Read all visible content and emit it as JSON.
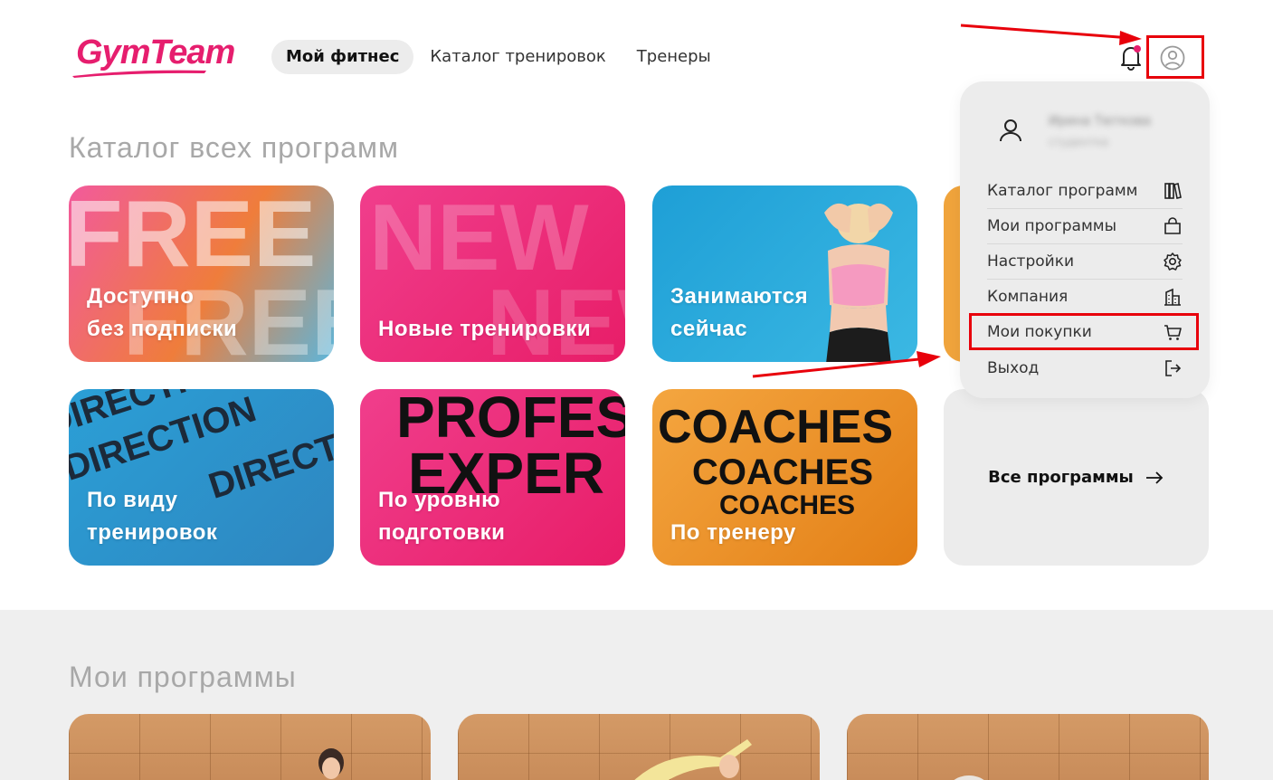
{
  "logo": {
    "text": "GymTeam"
  },
  "nav": {
    "items": [
      {
        "label": "Мой фитнес",
        "active": true
      },
      {
        "label": "Каталог тренировок",
        "active": false
      },
      {
        "label": "Тренеры",
        "active": false
      }
    ]
  },
  "header_icons": {
    "bell": "bell-icon",
    "user": "user-circle-icon"
  },
  "catalog": {
    "title": "Каталог всех программ",
    "cards": [
      {
        "label": "Доступно\nбез подписки",
        "graphic": "FREE"
      },
      {
        "label": "Новые тренировки",
        "graphic": "NEW"
      },
      {
        "label": "Занимаются\nсейчас"
      },
      {
        "label": "По виду\nтренировок",
        "graphic": "DIRECTION"
      },
      {
        "label": "По уровню\nподготовки",
        "graphic": "PROFES EXPER"
      },
      {
        "label": "По тренеру",
        "graphic": "COACHES"
      }
    ],
    "all_programs": "Все программы"
  },
  "my_programs": {
    "title": "Мои программы"
  },
  "dropdown": {
    "user_name": "Ирина Тюткова",
    "user_sub": "студентка",
    "items": [
      {
        "label": "Каталог программ",
        "icon": "books-icon"
      },
      {
        "label": "Мои программы",
        "icon": "bag-icon"
      },
      {
        "label": "Настройки",
        "icon": "gear-icon"
      },
      {
        "label": "Компания",
        "icon": "building-icon"
      },
      {
        "label": "Мои покупки",
        "icon": "cart-icon"
      },
      {
        "label": "Выход",
        "icon": "logout-icon"
      }
    ]
  },
  "colors": {
    "brand": "#e61e6e",
    "annotation": "#e8000b"
  }
}
